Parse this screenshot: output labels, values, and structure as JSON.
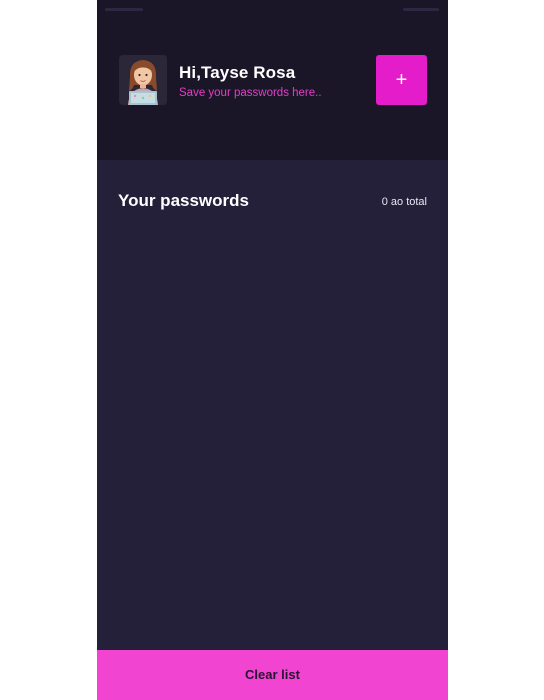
{
  "header": {
    "greeting": "Hi,Tayse Rosa",
    "subtitle": "Save your passwords here..",
    "add_label": "+"
  },
  "passwords": {
    "title": "Your passwords",
    "count_text": "0 ao total",
    "items": []
  },
  "footer": {
    "clear_label": "Clear list"
  },
  "icons": {
    "avatar": "user-avatar-icon",
    "add": "plus-icon"
  },
  "colors": {
    "header_background": "#1a1628",
    "screen_background": "#24203a",
    "accent": "#e41cc9",
    "subtitle_accent": "#e63dc8",
    "clear_button": "#f044d1",
    "text_primary": "#ffffff"
  }
}
